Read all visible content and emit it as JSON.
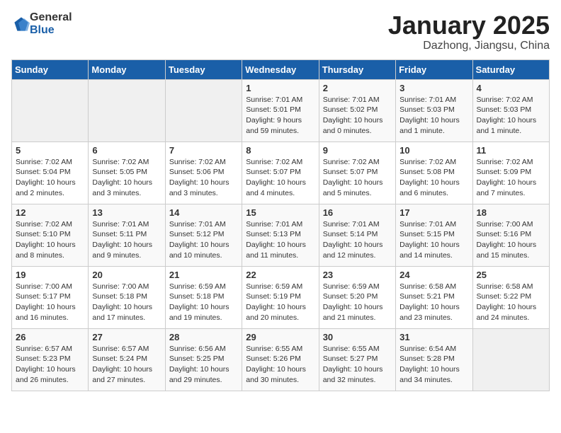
{
  "header": {
    "logo_general": "General",
    "logo_blue": "Blue",
    "title": "January 2025",
    "subtitle": "Dazhong, Jiangsu, China"
  },
  "weekdays": [
    "Sunday",
    "Monday",
    "Tuesday",
    "Wednesday",
    "Thursday",
    "Friday",
    "Saturday"
  ],
  "weeks": [
    [
      {
        "day": "",
        "info": ""
      },
      {
        "day": "",
        "info": ""
      },
      {
        "day": "",
        "info": ""
      },
      {
        "day": "1",
        "info": "Sunrise: 7:01 AM\nSunset: 5:01 PM\nDaylight: 9 hours\nand 59 minutes."
      },
      {
        "day": "2",
        "info": "Sunrise: 7:01 AM\nSunset: 5:02 PM\nDaylight: 10 hours\nand 0 minutes."
      },
      {
        "day": "3",
        "info": "Sunrise: 7:01 AM\nSunset: 5:03 PM\nDaylight: 10 hours\nand 1 minute."
      },
      {
        "day": "4",
        "info": "Sunrise: 7:02 AM\nSunset: 5:03 PM\nDaylight: 10 hours\nand 1 minute."
      }
    ],
    [
      {
        "day": "5",
        "info": "Sunrise: 7:02 AM\nSunset: 5:04 PM\nDaylight: 10 hours\nand 2 minutes."
      },
      {
        "day": "6",
        "info": "Sunrise: 7:02 AM\nSunset: 5:05 PM\nDaylight: 10 hours\nand 3 minutes."
      },
      {
        "day": "7",
        "info": "Sunrise: 7:02 AM\nSunset: 5:06 PM\nDaylight: 10 hours\nand 3 minutes."
      },
      {
        "day": "8",
        "info": "Sunrise: 7:02 AM\nSunset: 5:07 PM\nDaylight: 10 hours\nand 4 minutes."
      },
      {
        "day": "9",
        "info": "Sunrise: 7:02 AM\nSunset: 5:07 PM\nDaylight: 10 hours\nand 5 minutes."
      },
      {
        "day": "10",
        "info": "Sunrise: 7:02 AM\nSunset: 5:08 PM\nDaylight: 10 hours\nand 6 minutes."
      },
      {
        "day": "11",
        "info": "Sunrise: 7:02 AM\nSunset: 5:09 PM\nDaylight: 10 hours\nand 7 minutes."
      }
    ],
    [
      {
        "day": "12",
        "info": "Sunrise: 7:02 AM\nSunset: 5:10 PM\nDaylight: 10 hours\nand 8 minutes."
      },
      {
        "day": "13",
        "info": "Sunrise: 7:01 AM\nSunset: 5:11 PM\nDaylight: 10 hours\nand 9 minutes."
      },
      {
        "day": "14",
        "info": "Sunrise: 7:01 AM\nSunset: 5:12 PM\nDaylight: 10 hours\nand 10 minutes."
      },
      {
        "day": "15",
        "info": "Sunrise: 7:01 AM\nSunset: 5:13 PM\nDaylight: 10 hours\nand 11 minutes."
      },
      {
        "day": "16",
        "info": "Sunrise: 7:01 AM\nSunset: 5:14 PM\nDaylight: 10 hours\nand 12 minutes."
      },
      {
        "day": "17",
        "info": "Sunrise: 7:01 AM\nSunset: 5:15 PM\nDaylight: 10 hours\nand 14 minutes."
      },
      {
        "day": "18",
        "info": "Sunrise: 7:00 AM\nSunset: 5:16 PM\nDaylight: 10 hours\nand 15 minutes."
      }
    ],
    [
      {
        "day": "19",
        "info": "Sunrise: 7:00 AM\nSunset: 5:17 PM\nDaylight: 10 hours\nand 16 minutes."
      },
      {
        "day": "20",
        "info": "Sunrise: 7:00 AM\nSunset: 5:18 PM\nDaylight: 10 hours\nand 17 minutes."
      },
      {
        "day": "21",
        "info": "Sunrise: 6:59 AM\nSunset: 5:18 PM\nDaylight: 10 hours\nand 19 minutes."
      },
      {
        "day": "22",
        "info": "Sunrise: 6:59 AM\nSunset: 5:19 PM\nDaylight: 10 hours\nand 20 minutes."
      },
      {
        "day": "23",
        "info": "Sunrise: 6:59 AM\nSunset: 5:20 PM\nDaylight: 10 hours\nand 21 minutes."
      },
      {
        "day": "24",
        "info": "Sunrise: 6:58 AM\nSunset: 5:21 PM\nDaylight: 10 hours\nand 23 minutes."
      },
      {
        "day": "25",
        "info": "Sunrise: 6:58 AM\nSunset: 5:22 PM\nDaylight: 10 hours\nand 24 minutes."
      }
    ],
    [
      {
        "day": "26",
        "info": "Sunrise: 6:57 AM\nSunset: 5:23 PM\nDaylight: 10 hours\nand 26 minutes."
      },
      {
        "day": "27",
        "info": "Sunrise: 6:57 AM\nSunset: 5:24 PM\nDaylight: 10 hours\nand 27 minutes."
      },
      {
        "day": "28",
        "info": "Sunrise: 6:56 AM\nSunset: 5:25 PM\nDaylight: 10 hours\nand 29 minutes."
      },
      {
        "day": "29",
        "info": "Sunrise: 6:55 AM\nSunset: 5:26 PM\nDaylight: 10 hours\nand 30 minutes."
      },
      {
        "day": "30",
        "info": "Sunrise: 6:55 AM\nSunset: 5:27 PM\nDaylight: 10 hours\nand 32 minutes."
      },
      {
        "day": "31",
        "info": "Sunrise: 6:54 AM\nSunset: 5:28 PM\nDaylight: 10 hours\nand 34 minutes."
      },
      {
        "day": "",
        "info": ""
      }
    ]
  ]
}
